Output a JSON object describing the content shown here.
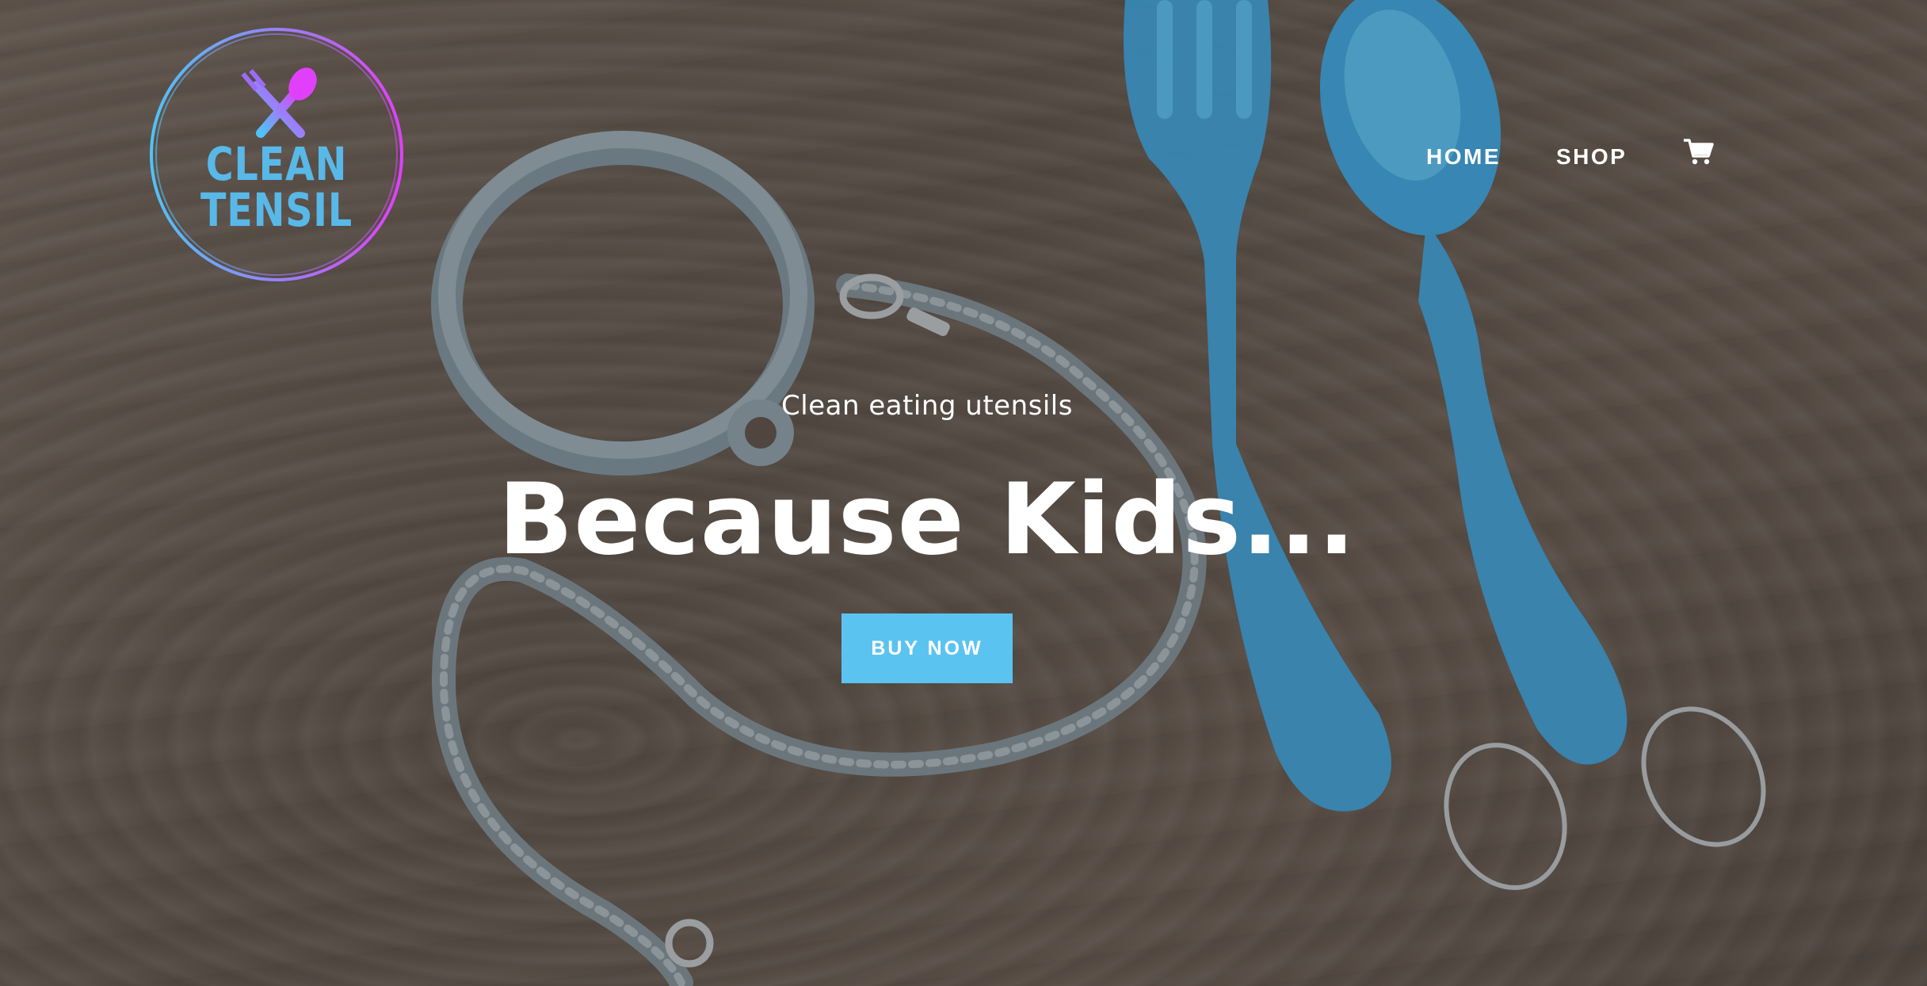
{
  "brand": {
    "logo_line1": "CLEAN",
    "logo_line2": "TENSIL",
    "logo_text_color": "#58b8e8",
    "logo_ring_colors": [
      "#4fc3f7",
      "#e040fb"
    ]
  },
  "nav": {
    "items": [
      {
        "label": "HOME"
      },
      {
        "label": "SHOP"
      }
    ],
    "cart_icon": "cart-icon"
  },
  "hero": {
    "subtitle": "Clean eating utensils",
    "headline": "Because Kids...",
    "cta_label": "BUY NOW",
    "cta_color": "#5bc3f0",
    "background_description_colors": {
      "wood": "#65584e",
      "utensils": "#3f9fd6",
      "silicone_ring": "#8a9aa4"
    }
  }
}
